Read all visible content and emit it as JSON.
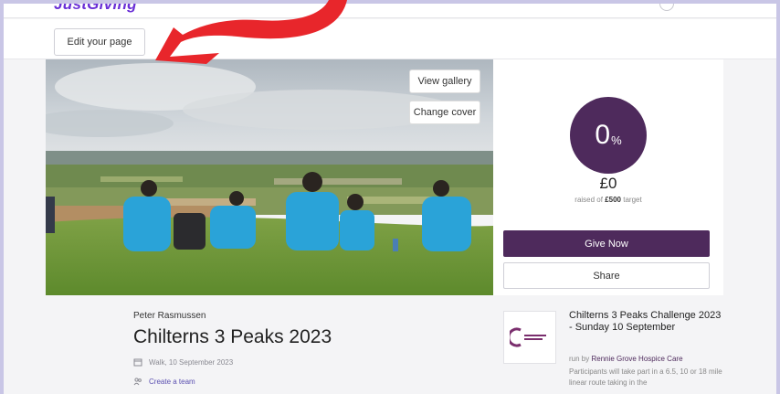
{
  "header": {
    "edit_label": "Edit your page"
  },
  "hero": {
    "gallery_label": "View gallery",
    "cover_label": "Change cover"
  },
  "fundraising": {
    "percent": "0",
    "percent_symbol": "%",
    "progress_fraction": 0,
    "raised": "£0",
    "raised_prefix": "raised of",
    "target_amount": "£500",
    "target_suffix": "target",
    "give_label": "Give Now",
    "share_label": "Share"
  },
  "page": {
    "owner": "Peter Rasmussen",
    "title": "Chilterns 3 Peaks 2023",
    "date": "Walk, 10 September 2023",
    "team_link": "Create a team"
  },
  "event": {
    "title": "Chilterns 3 Peaks Challenge 2023 - Sunday 10 September",
    "run_by_prefix": "run by",
    "charity": "Rennie Grove Hospice Care",
    "description": "Participants will take part in a 6.5, 10 or 18 mile linear route taking in the"
  },
  "colors": {
    "brand_purple": "#4e2a5c",
    "annotation_red": "#e8262b",
    "shirt_blue": "#2aa3d8"
  }
}
